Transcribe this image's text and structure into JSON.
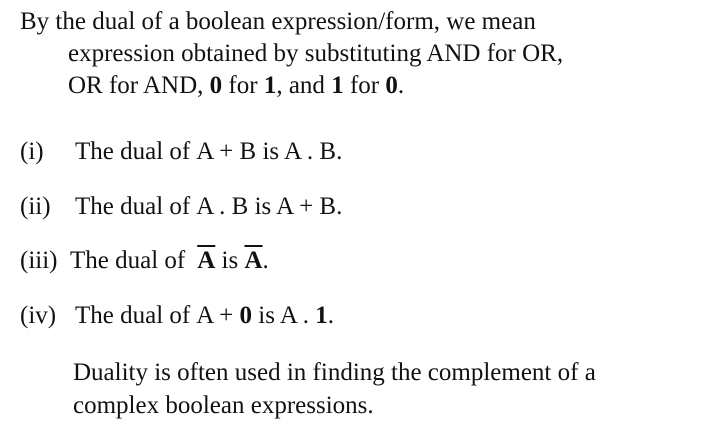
{
  "intro": {
    "line1": "By the dual of a boolean expression/form,  we mean",
    "line2": "expression obtained by substituting AND for OR,",
    "line3_a": "OR for AND, ",
    "zero": "0",
    "line3_b": " for ",
    "one": "1",
    "line3_c": ", and ",
    "line3_d": " for ",
    "line3_e": "."
  },
  "items": [
    {
      "num": "(i)",
      "prefix": "The dual of",
      "expr": "A + B",
      "is": " is ",
      "result": "A . B",
      "end": "."
    },
    {
      "num": "(ii)",
      "prefix": "The dual of",
      "expr": "A . B",
      "is": " is ",
      "result": "A + B",
      "end": "."
    },
    {
      "num": "(iii)",
      "prefix": "The dual of",
      "expr": "A",
      "is": " is ",
      "result": "A",
      "end": "."
    },
    {
      "num": "(iv)",
      "prefix": "The dual of",
      "expr_a": "A + ",
      "expr_b": "0",
      "is": " is ",
      "result_a": "A . ",
      "result_b": "1",
      "end": "."
    }
  ],
  "closing": {
    "line1": "Duality is often used in finding the complement of a",
    "line2": "complex boolean expressions."
  }
}
